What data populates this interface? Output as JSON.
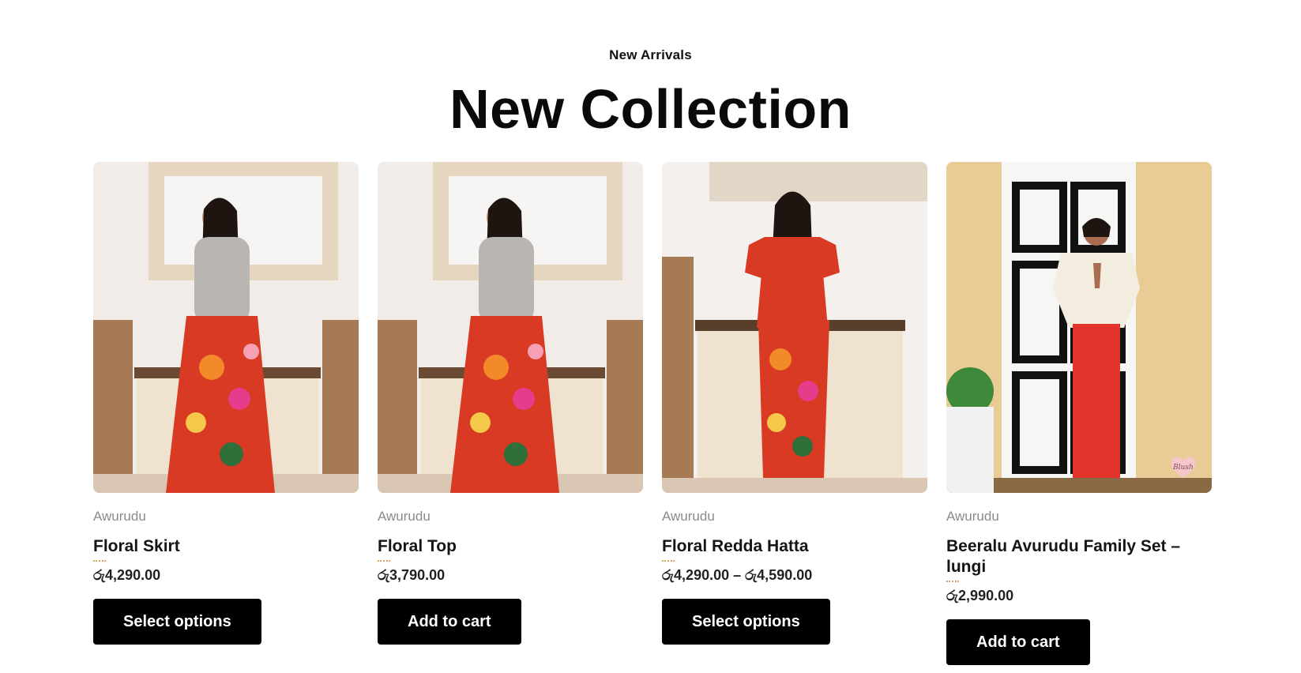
{
  "section": {
    "eyebrow": "New Arrivals",
    "title": "New Collection"
  },
  "products": [
    {
      "category": "Awurudu",
      "title": "Floral Skirt",
      "price": "රු4,290.00",
      "button": "Select options",
      "image": "woman-floral-skirt-photo"
    },
    {
      "category": "Awurudu",
      "title": "Floral Top",
      "price": "රු3,790.00",
      "button": "Add to cart",
      "image": "woman-floral-top-photo"
    },
    {
      "category": "Awurudu",
      "title": "Floral Redda Hatta",
      "price": "රු4,290.00 – රු4,590.00",
      "button": "Select options",
      "image": "girl-floral-dress-photo"
    },
    {
      "category": "Awurudu",
      "title": "Beeralu Avurudu Family Set – lungi",
      "price": "රු2,990.00",
      "button": "Add to cart",
      "image": "woman-red-lungi-photo",
      "watermark": "Blush"
    }
  ],
  "colors": {
    "button_bg": "#000000",
    "button_text": "#ffffff",
    "category_text": "#8a8a8a",
    "rating_dots": "#e0a060"
  }
}
